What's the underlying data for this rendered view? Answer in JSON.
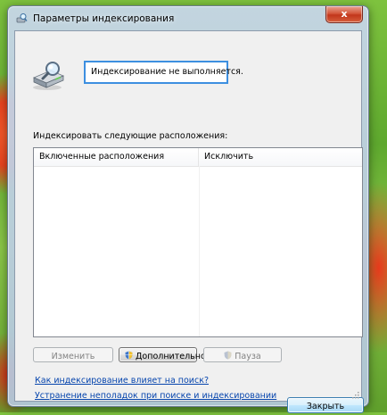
{
  "window": {
    "title": "Параметры индексирования",
    "close_label": "x"
  },
  "status": {
    "text": "Индексирование не выполняется."
  },
  "locations": {
    "label": "Индексировать следующие расположения:",
    "columns": [
      "Включенные расположения",
      "Исключить"
    ],
    "rows": []
  },
  "buttons": {
    "edit": "Изменить",
    "advanced": "Дополнительно",
    "pause": "Пауза",
    "close": "Закрыть"
  },
  "links": {
    "how_affects": "Как индексирование влияет на поиск?",
    "troubleshoot": "Устранение неполадок при поиске и индексировании"
  },
  "icons": {
    "title": "indexing-options-icon",
    "drive": "drive-search-icon",
    "shield": "uac-shield-icon"
  }
}
